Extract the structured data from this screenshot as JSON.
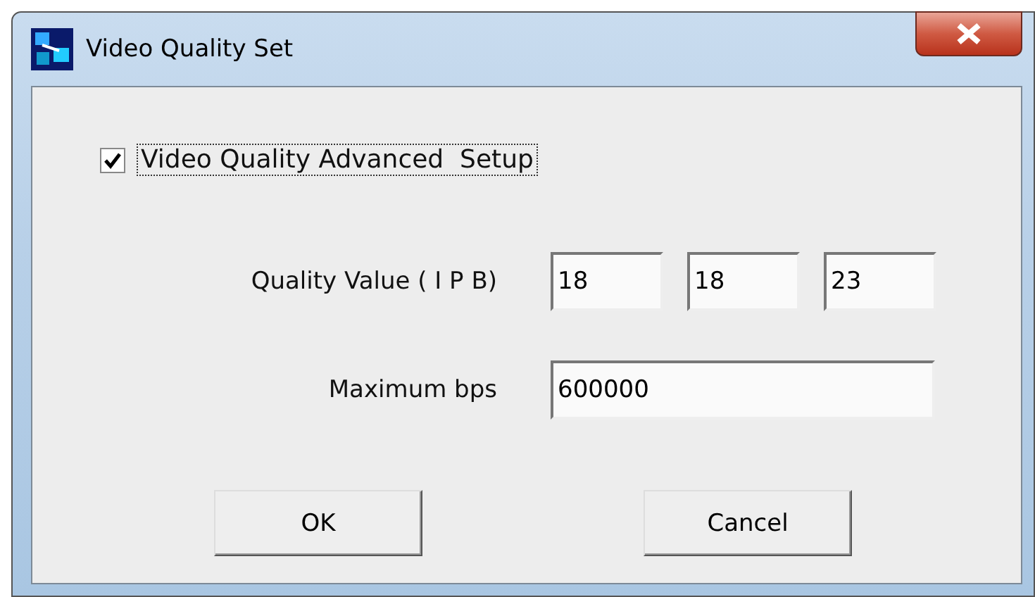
{
  "window": {
    "title": "Video Quality Set"
  },
  "advanced_setup": {
    "label": "Video Quality Advanced  Setup",
    "checked": true
  },
  "quality": {
    "label": "Quality Value ( I P B)",
    "values": [
      "18",
      "18",
      "23"
    ]
  },
  "max_bps": {
    "label": "Maximum bps",
    "value": "600000"
  },
  "buttons": [
    "OK",
    "Cancel"
  ]
}
